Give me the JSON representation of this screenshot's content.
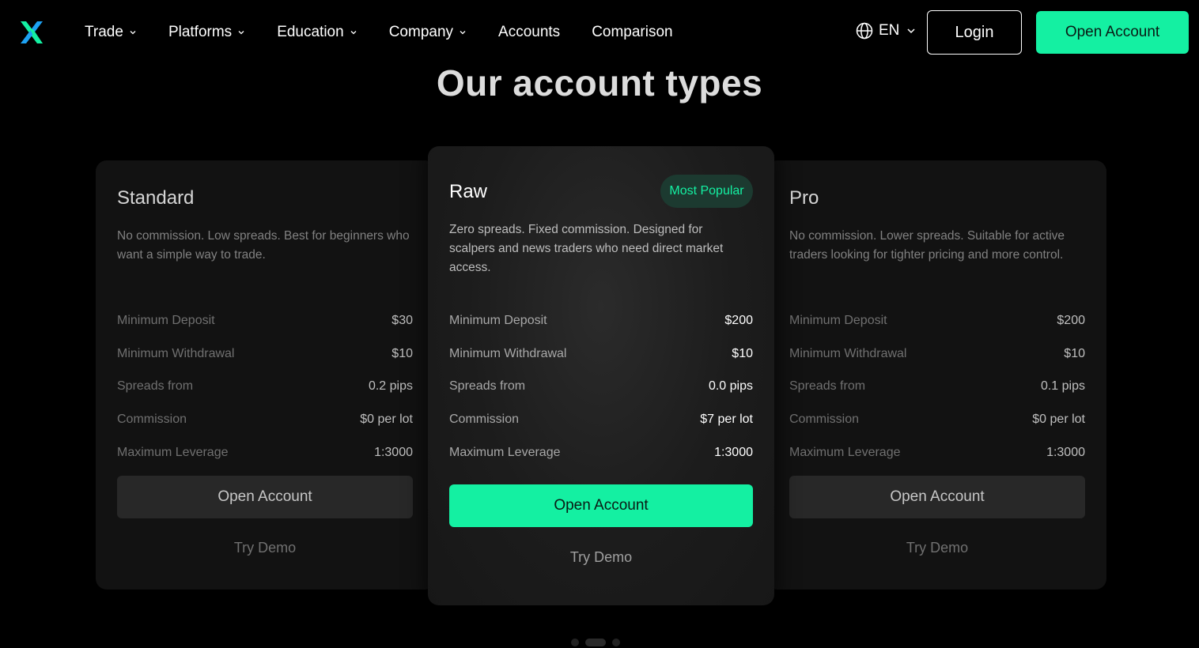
{
  "nav": {
    "menu": [
      {
        "label": "Trade",
        "has_dropdown": true
      },
      {
        "label": "Platforms",
        "has_dropdown": true
      },
      {
        "label": "Education",
        "has_dropdown": true
      },
      {
        "label": "Company",
        "has_dropdown": true
      },
      {
        "label": "Accounts",
        "has_dropdown": false
      },
      {
        "label": "Comparison",
        "has_dropdown": false
      }
    ],
    "language": "EN",
    "login_label": "Login",
    "open_account_label": "Open Account"
  },
  "heading": "Our account types",
  "accounts": [
    {
      "name": "Standard",
      "description": "No commission. Low spreads. Best for beginners who want a simple way to trade.",
      "specs": [
        {
          "label": "Minimum Deposit",
          "value": "$30"
        },
        {
          "label": "Minimum Withdrawal",
          "value": "$10"
        },
        {
          "label": "Spreads from",
          "value": "0.2 pips"
        },
        {
          "label": "Commission",
          "value": "$0 per lot"
        },
        {
          "label": "Maximum Leverage",
          "value": "1:3000"
        }
      ],
      "open_label": "Open Account",
      "demo_label": "Try Demo"
    },
    {
      "name": "Raw",
      "badge": "Most Popular",
      "description": "Zero spreads. Fixed commission. Designed for scalpers and news traders who need direct market access.",
      "specs": [
        {
          "label": "Minimum Deposit",
          "value": "$200"
        },
        {
          "label": "Minimum Withdrawal",
          "value": "$10"
        },
        {
          "label": "Spreads from",
          "value": "0.0 pips"
        },
        {
          "label": "Commission",
          "value": "$7 per lot"
        },
        {
          "label": "Maximum Leverage",
          "value": "1:3000"
        }
      ],
      "open_label": "Open Account",
      "demo_label": "Try Demo"
    },
    {
      "name": "Pro",
      "description": "No commission. Lower spreads. Suitable for active traders looking for tighter pricing and more control.",
      "specs": [
        {
          "label": "Minimum Deposit",
          "value": "$200"
        },
        {
          "label": "Minimum Withdrawal",
          "value": "$10"
        },
        {
          "label": "Spreads from",
          "value": "0.1 pips"
        },
        {
          "label": "Commission",
          "value": "$0 per lot"
        },
        {
          "label": "Maximum Leverage",
          "value": "1:3000"
        }
      ],
      "open_label": "Open Account",
      "demo_label": "Try Demo"
    }
  ],
  "colors": {
    "accent": "#14f0a2",
    "background": "#000000",
    "card": "#141414",
    "badge_bg": "#1c3a30"
  },
  "icons": {
    "logo": "x-logo-icon",
    "language": "globe-icon",
    "dropdown": "chevron-down-icon"
  }
}
